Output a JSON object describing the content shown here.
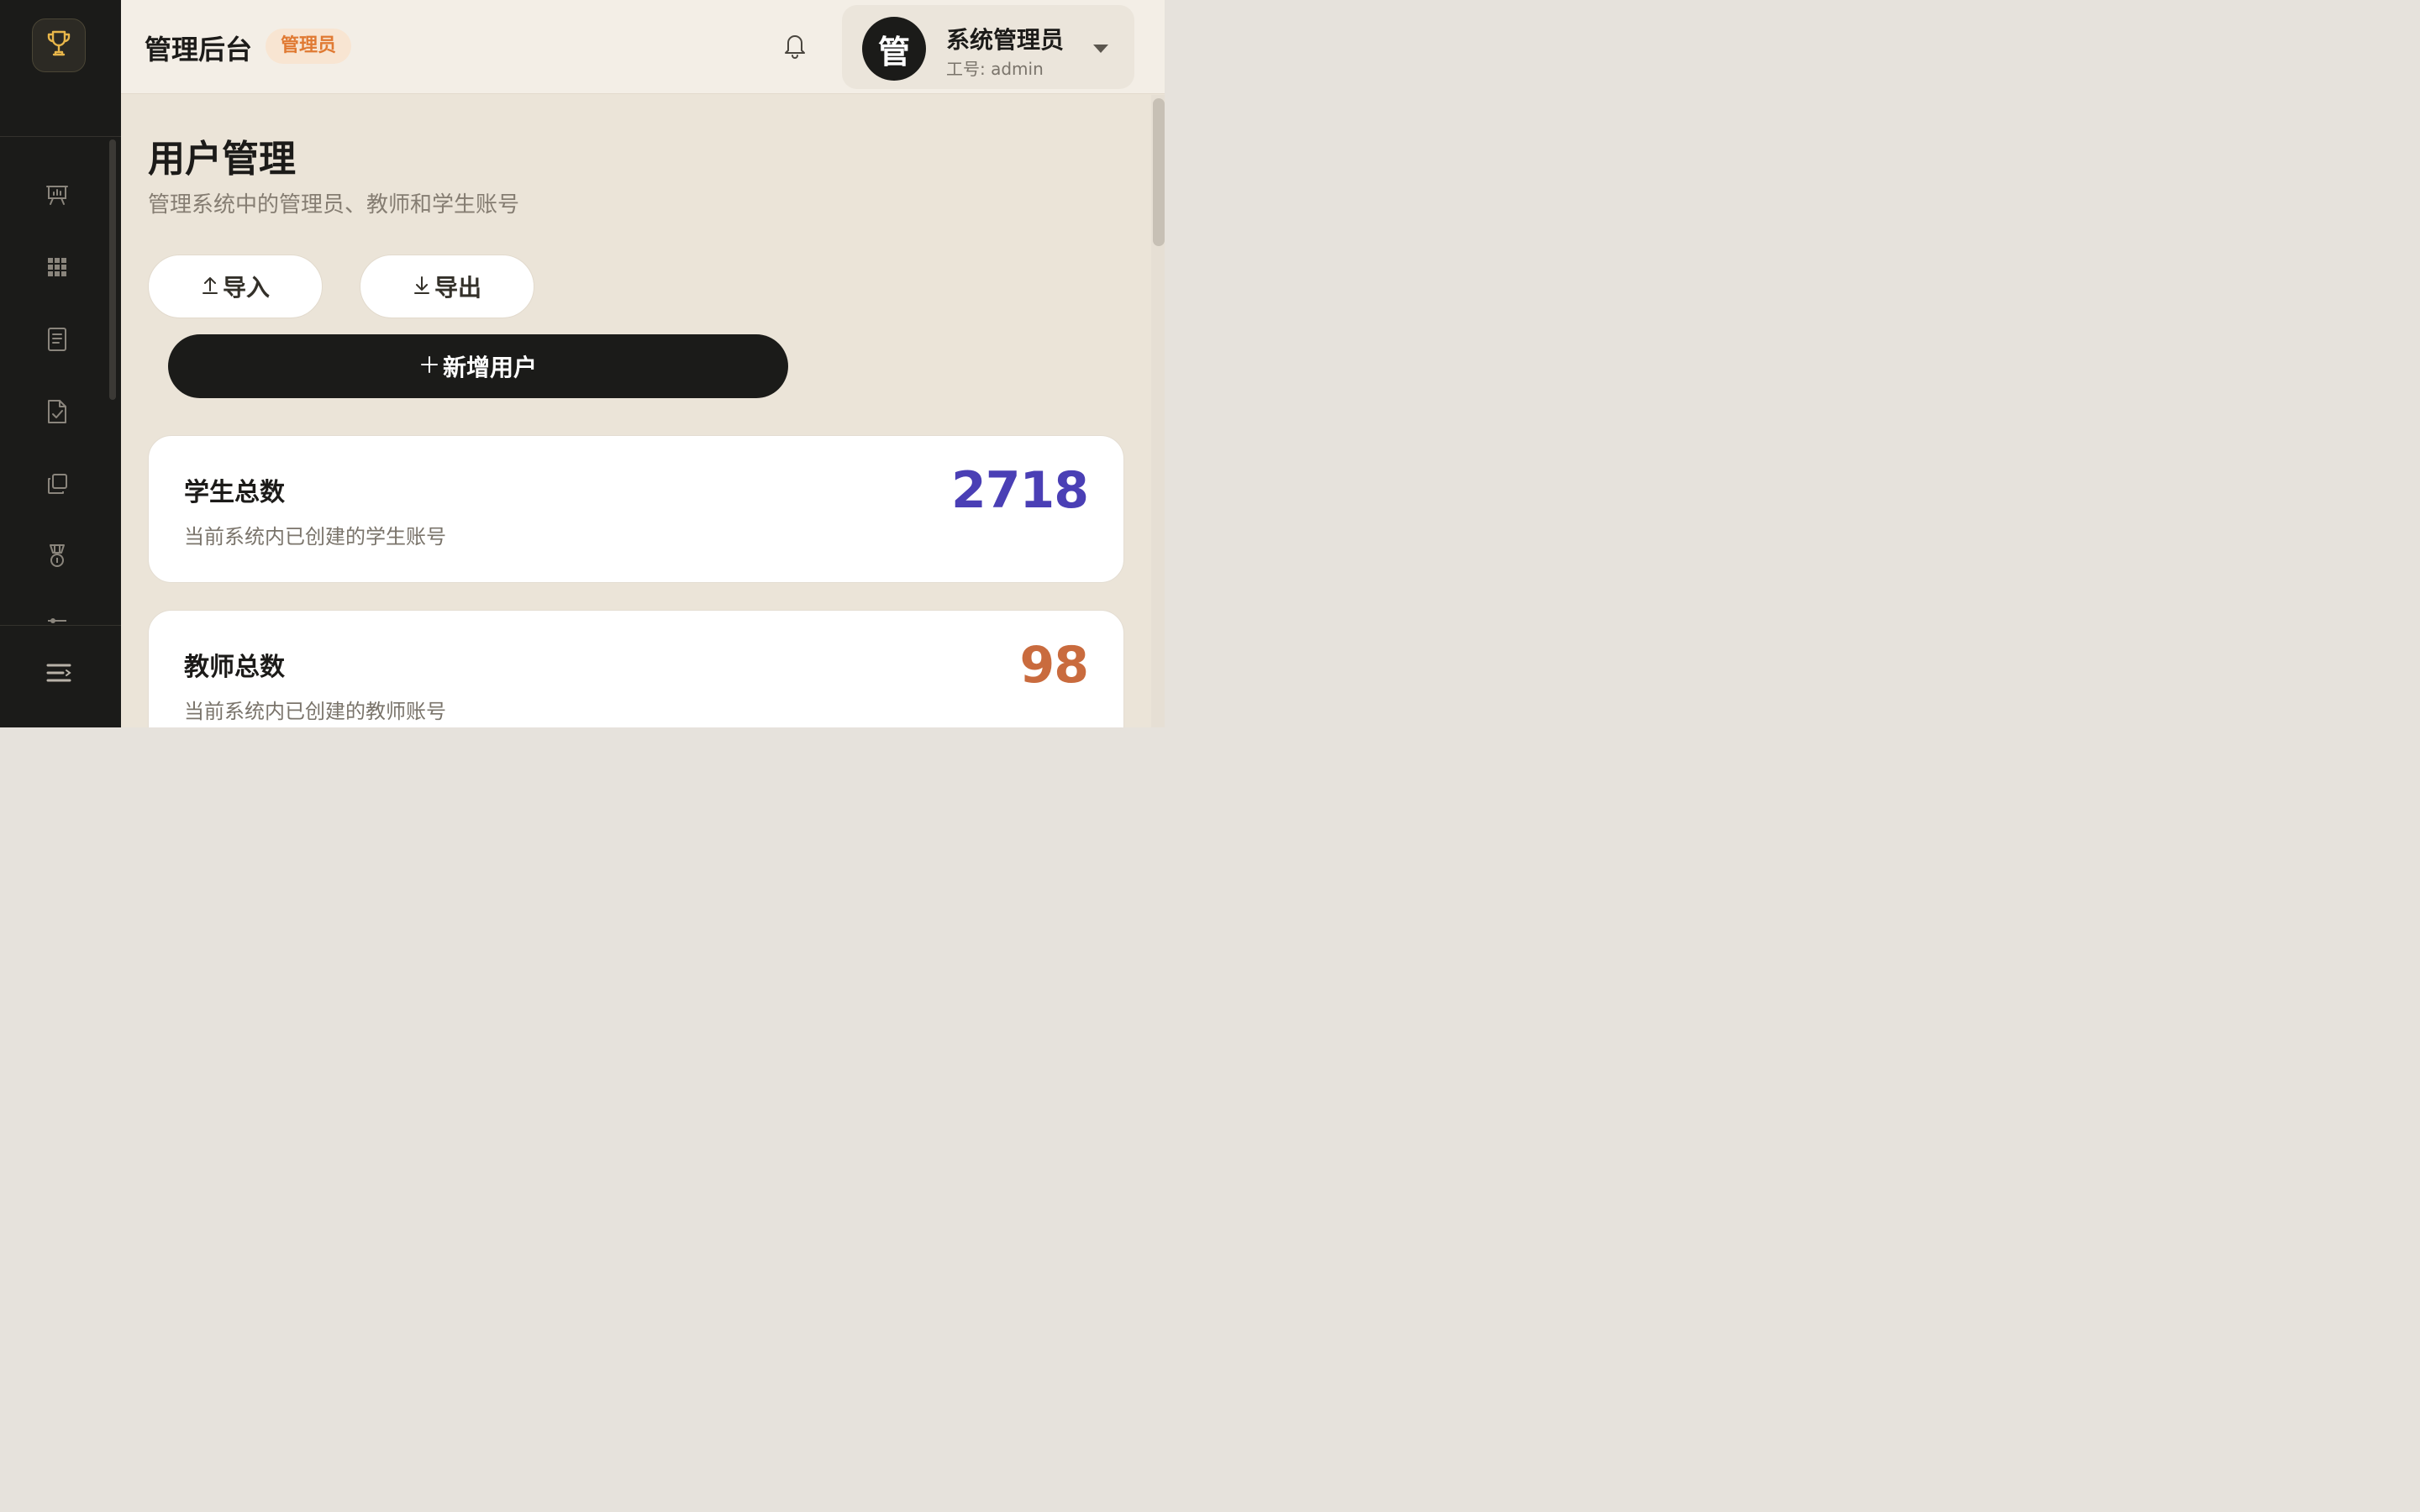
{
  "header": {
    "app_title": "管理后台",
    "role_badge": "管理员",
    "user": {
      "avatar_char": "管",
      "name": "系统管理员",
      "employee_id": "工号: admin"
    }
  },
  "sidebar": {
    "icons": [
      "trophy-icon",
      "presentation-chart-icon",
      "grid-apps-icon",
      "document-icon",
      "file-check-icon",
      "copy-layers-icon",
      "medal-icon",
      "slider-icon",
      "collapse-menu-icon"
    ]
  },
  "main": {
    "title": "用户管理",
    "subtitle": "管理系统中的管理员、教师和学生账号",
    "buttons": {
      "import": "导入",
      "export": "导出",
      "add_user": "新增用户"
    },
    "stats": [
      {
        "title": "学生总数",
        "description": "当前系统内已创建的学生账号",
        "value": "2718",
        "color": "#4a3fb5"
      },
      {
        "title": "教师总数",
        "description": "当前系统内已创建的教师账号",
        "value": "98",
        "color": "#c96b3e"
      }
    ]
  },
  "colors": {
    "accent_dark": "#1b1b19",
    "badge_text": "#e07a33",
    "badge_bg": "#f8e5d2",
    "student_value": "#4a3fb5",
    "teacher_value": "#c96b3e",
    "trophy": "#e8b64a"
  }
}
